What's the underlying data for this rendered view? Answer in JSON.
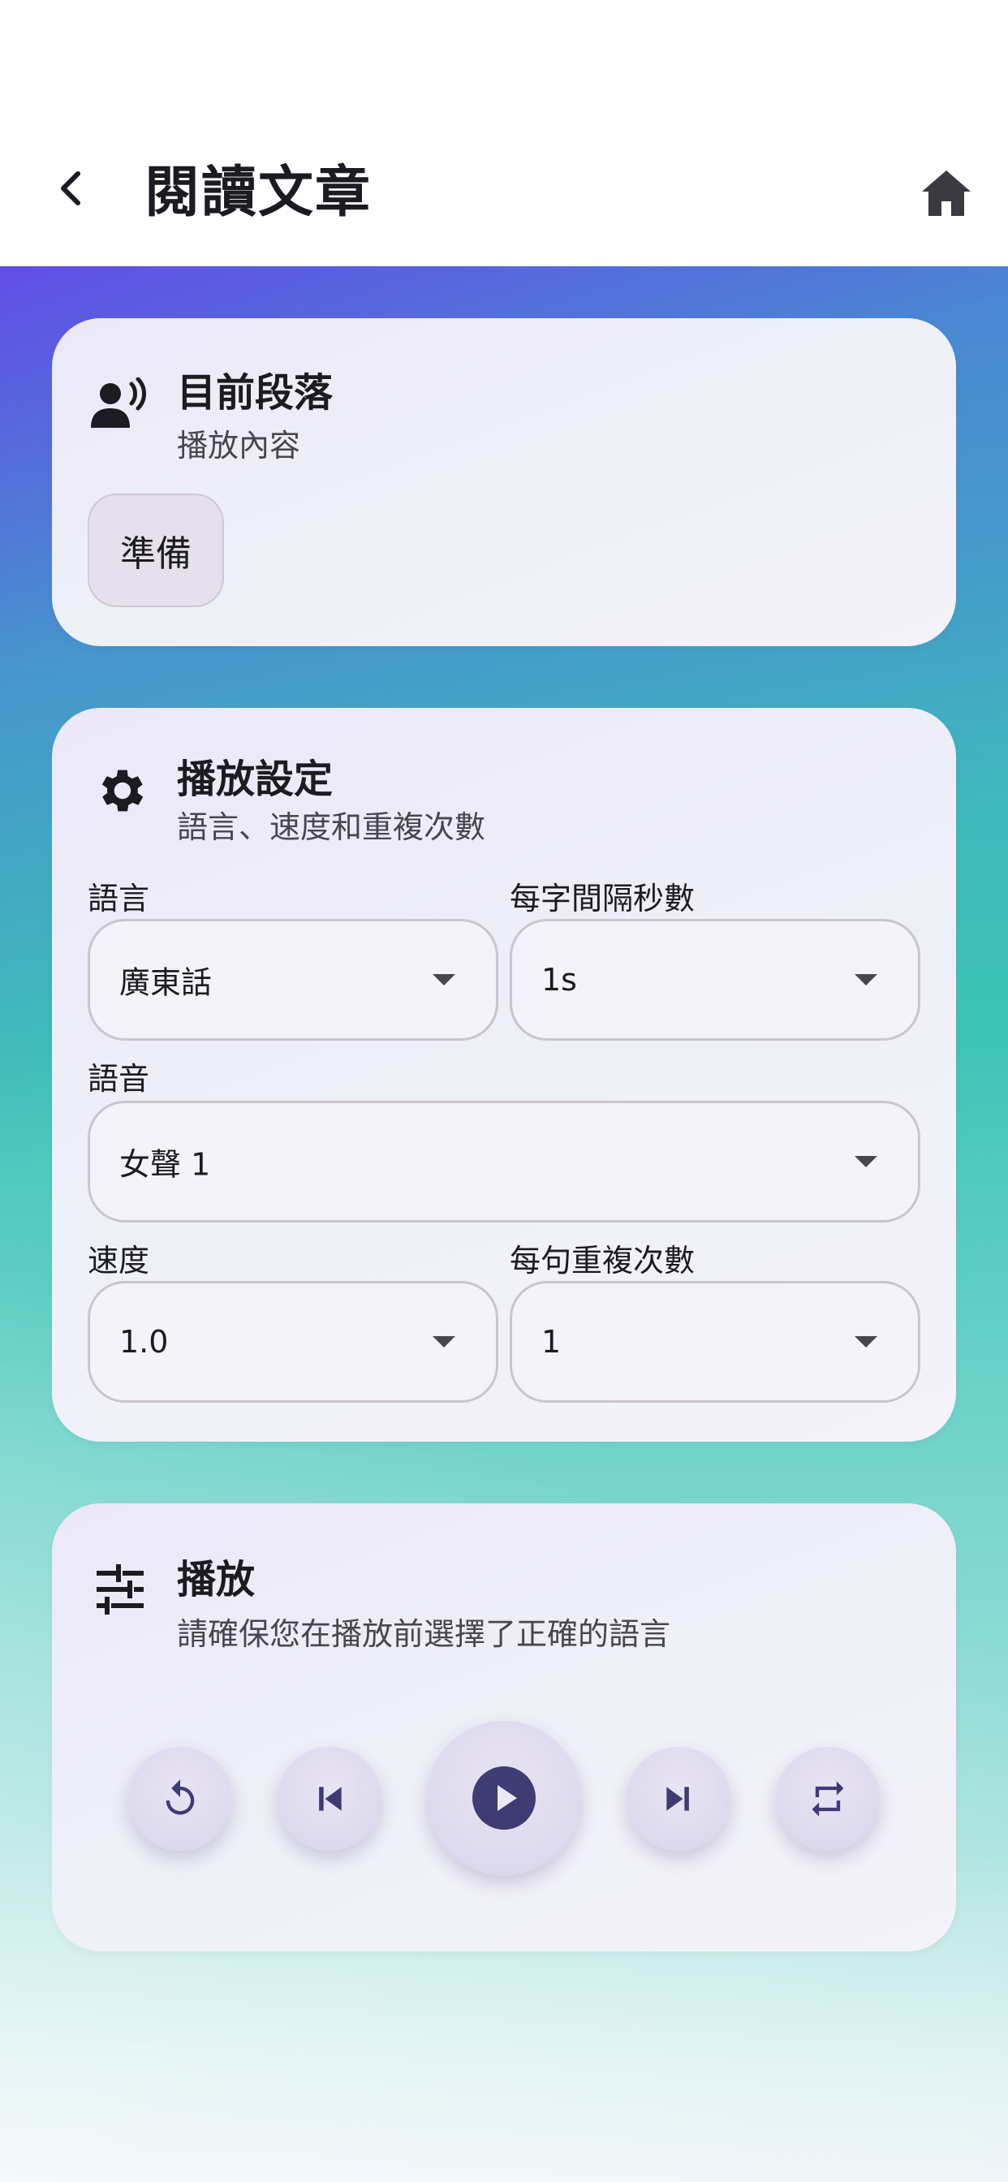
{
  "header": {
    "title": "閱讀文章",
    "back_icon": "chevron-left-icon",
    "home_icon": "home-icon"
  },
  "current_paragraph": {
    "icon": "record-voice-icon",
    "title": "目前段落",
    "subtitle": "播放內容",
    "status_button": "準備"
  },
  "settings": {
    "icon": "gear-icon",
    "title": "播放設定",
    "subtitle": "語言、速度和重複次數",
    "language": {
      "label": "語言",
      "value": "廣東話"
    },
    "interval": {
      "label": "每字間隔秒數",
      "value": "1s"
    },
    "voice": {
      "label": "語音",
      "value": "女聲 1"
    },
    "speed": {
      "label": "速度",
      "value": "1.0"
    },
    "repeat": {
      "label": "每句重複次數",
      "value": "1"
    }
  },
  "playback": {
    "icon": "tune-icon",
    "title": "播放",
    "subtitle": "請確保您在播放前選擇了正確的語言",
    "controls": [
      "replay-icon",
      "skip-previous-icon",
      "play-icon",
      "skip-next-icon",
      "repeat-icon"
    ]
  },
  "colors": {
    "accent": "#3f3b73",
    "card_bg": "#eef0f8",
    "gradient_top": "#5b4ae6",
    "gradient_mid": "#3ec4b5",
    "gradient_bottom": "#e7f1f6"
  }
}
